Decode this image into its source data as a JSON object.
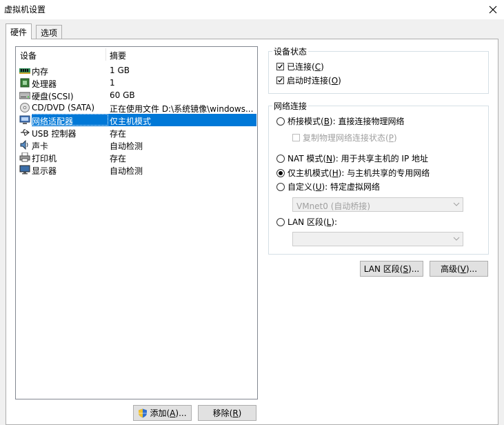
{
  "window": {
    "title": "虚拟机设置"
  },
  "tabs": [
    {
      "label": "硬件"
    },
    {
      "label": "选项"
    }
  ],
  "device_list": {
    "headers": {
      "device": "设备",
      "summary": "摘要"
    },
    "rows": [
      {
        "name": "内存",
        "summary": "1 GB",
        "icon": "memory-icon"
      },
      {
        "name": "处理器",
        "summary": "1",
        "icon": "processor-icon"
      },
      {
        "name": "硬盘(SCSI)",
        "summary": "60 GB",
        "icon": "harddisk-icon"
      },
      {
        "name": "CD/DVD (SATA)",
        "summary": "正在使用文件 D:\\系统镜像\\windows...",
        "icon": "cd-dvd-icon"
      },
      {
        "name": "网络适配器",
        "summary": "仅主机模式",
        "icon": "network-adapter-icon",
        "selected": true
      },
      {
        "name": "USB 控制器",
        "summary": "存在",
        "icon": "usb-icon"
      },
      {
        "name": "声卡",
        "summary": "自动检测",
        "icon": "sound-card-icon"
      },
      {
        "name": "打印机",
        "summary": "存在",
        "icon": "printer-icon"
      },
      {
        "name": "显示器",
        "summary": "自动检测",
        "icon": "display-icon"
      }
    ]
  },
  "buttons": {
    "add": {
      "label_pre": "添加(",
      "key": "A",
      "label_post": ")...",
      "icon": "shield-icon"
    },
    "remove": {
      "label_pre": "移除(",
      "key": "R",
      "label_post": ")"
    },
    "lan_segment": {
      "label_pre": "LAN 区段(",
      "key": "S",
      "label_post": ")..."
    },
    "advanced": {
      "label_pre": "高级(",
      "key": "V",
      "label_post": ")..."
    }
  },
  "device_status": {
    "title": "设备状态",
    "connected": {
      "pre": "已连接(",
      "key": "C",
      "post": ")",
      "checked": true
    },
    "connect_on_power_on": {
      "pre": "启动时连接(",
      "key": "O",
      "post": ")",
      "checked": true
    }
  },
  "network_connection": {
    "title": "网络连接",
    "bridged": {
      "pre": "桥接模式(",
      "key": "B",
      "post": "): 直接连接物理网络",
      "selected": false
    },
    "replicate": {
      "pre": "复制物理网络连接状态(",
      "key": "P",
      "post": ")",
      "checked": false,
      "enabled": false
    },
    "nat": {
      "pre": "NAT 模式(",
      "key": "N",
      "post": "): 用于共享主机的 IP 地址",
      "selected": false
    },
    "host_only": {
      "pre": "仅主机模式(",
      "key": "H",
      "post": "): 与主机共享的专用网络",
      "selected": true
    },
    "custom": {
      "pre": "自定义(",
      "key": "U",
      "post": "): 特定虚拟网络",
      "selected": false
    },
    "custom_select": {
      "value": "VMnet0 (自动桥接)"
    },
    "lan_segment": {
      "pre": "LAN 区段(",
      "key": "L",
      "post": "):",
      "selected": false
    },
    "lan_select": {
      "value": ""
    }
  }
}
